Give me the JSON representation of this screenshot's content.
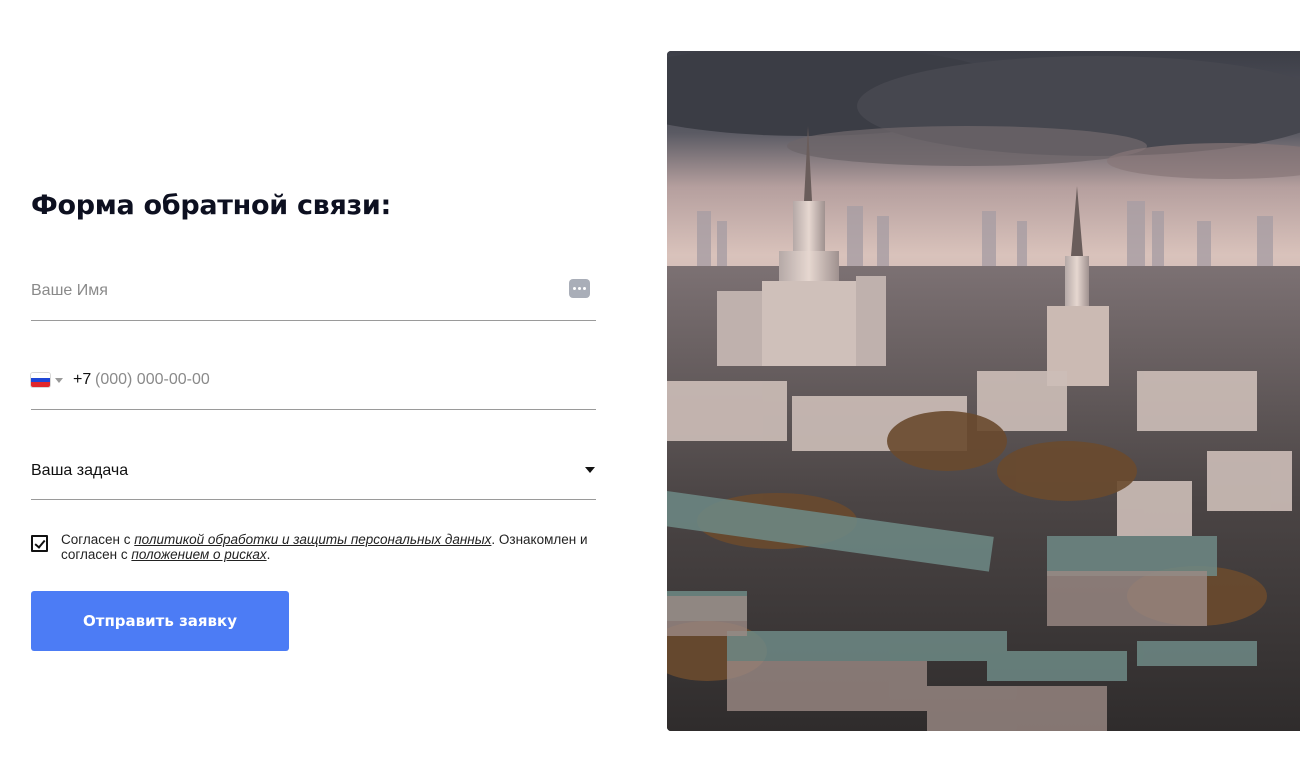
{
  "form": {
    "title": "Форма обратной связи:",
    "name_placeholder": "Ваше Имя",
    "phone_code": "+7",
    "phone_placeholder": "(000) 000-00-00",
    "task_label": "Ваша задача",
    "consent": {
      "prefix": "Согласен с ",
      "policy_link": "политикой обработки и защиты персональных данных",
      "middle": ". Ознакомлен и согласен с ",
      "risk_link": "положением о рисках",
      "suffix": ".",
      "checked": true
    },
    "submit_label": "Отправить заявку"
  },
  "colors": {
    "accent": "#4c7cf5",
    "title": "#0d1020",
    "divider": "#9a9a9a"
  },
  "icons": {
    "autofill": "autofill-dots-icon",
    "flag": "russia-flag-icon",
    "dropdown": "chevron-down-icon"
  }
}
